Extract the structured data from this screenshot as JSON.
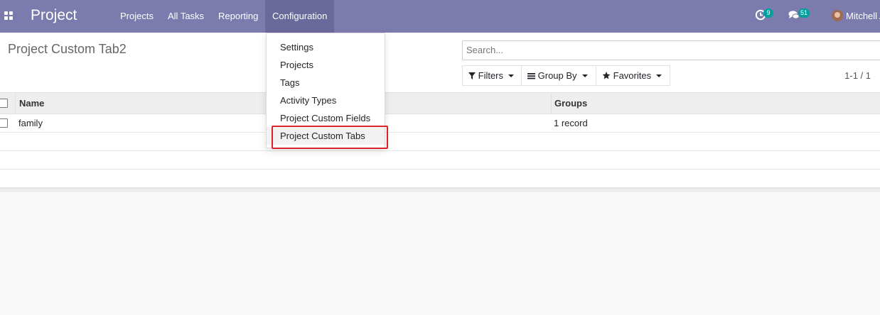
{
  "navbar": {
    "app_name": "Project",
    "menu": [
      {
        "label": "Projects"
      },
      {
        "label": "All Tasks"
      },
      {
        "label": "Reporting"
      },
      {
        "label": "Configuration"
      }
    ],
    "activity_count": "9",
    "messages_count": "51",
    "user_name": "Mitchell A",
    "colors": {
      "navbar": "#7c7bad",
      "badge": "#00a09d"
    }
  },
  "control_panel": {
    "title": "Project Custom Tab2",
    "search_placeholder": "Search...",
    "filters_label": "Filters",
    "groupby_label": "Group By",
    "favorites_label": "Favorites",
    "pager": "1-1 / 1"
  },
  "list": {
    "columns": [
      "Name",
      "Groups"
    ],
    "rows": [
      {
        "name": "family",
        "groups": "1 record"
      }
    ]
  },
  "config_menu": {
    "items": [
      {
        "label": "Settings"
      },
      {
        "label": "Projects"
      },
      {
        "label": "Tags"
      },
      {
        "label": "Activity Types"
      },
      {
        "label": "Project Custom Fields"
      },
      {
        "label": "Project Custom Tabs"
      }
    ],
    "highlight_color": "#d9252a"
  },
  "icons": [
    "apps-grid-icon",
    "activity-clock-icon",
    "chat-bubbles-icon",
    "filter-icon",
    "list-icon",
    "star-icon",
    "caret-down-icon"
  ]
}
